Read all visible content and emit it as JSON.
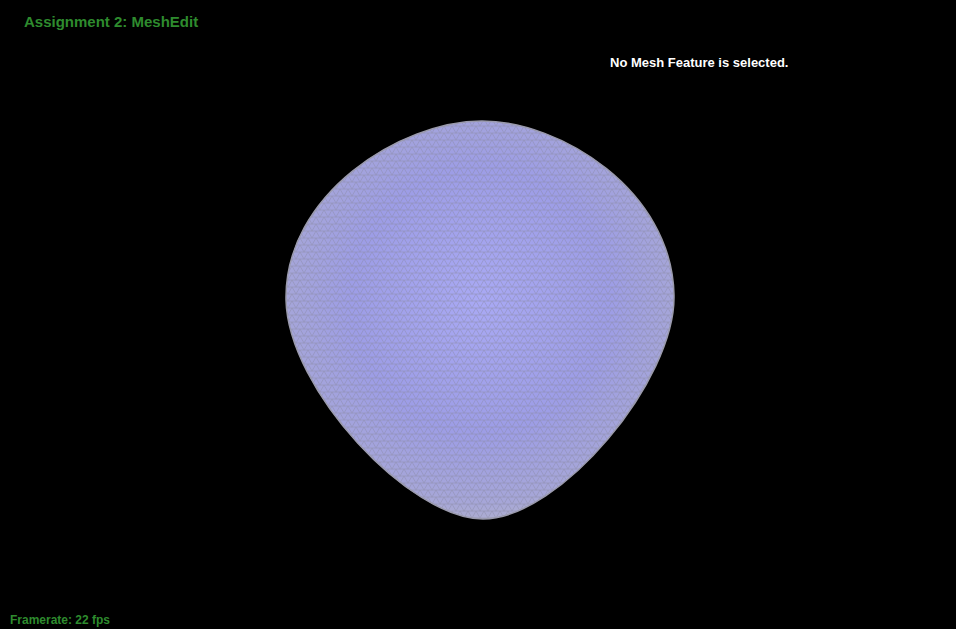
{
  "window": {
    "title": "Assignment 2: MeshEdit"
  },
  "selection_status": "No Mesh Feature is selected.",
  "framerate": "Framerate: 22 fps"
}
